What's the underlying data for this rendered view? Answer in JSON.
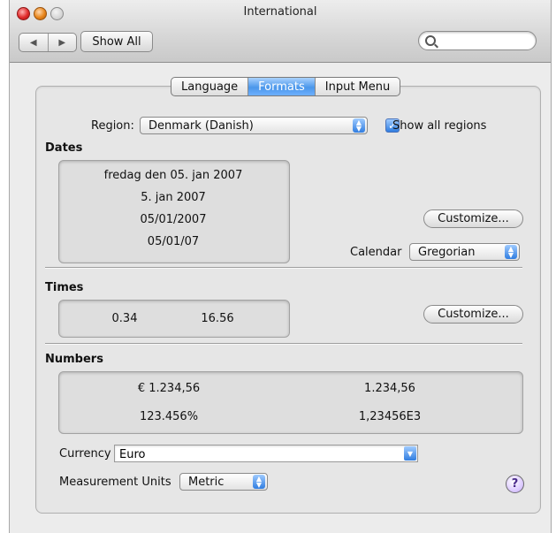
{
  "window": {
    "title": "International"
  },
  "toolbar": {
    "back_glyph": "◀",
    "forward_glyph": "▶",
    "show_all_label": "Show All",
    "search_value": "",
    "search_placeholder": ""
  },
  "tabs": [
    {
      "label": "Language",
      "active": false
    },
    {
      "label": "Formats",
      "active": true
    },
    {
      "label": "Input Menu",
      "active": false
    }
  ],
  "region": {
    "label": "Region:",
    "value": "Denmark (Danish)",
    "show_all_label": "Show all regions",
    "show_all_checked": true
  },
  "dates": {
    "heading": "Dates",
    "samples": [
      "fredag den 05. jan 2007",
      "5. jan 2007",
      "05/01/2007",
      "05/01/07"
    ],
    "customize_label": "Customize...",
    "calendar_label": "Calendar",
    "calendar_value": "Gregorian"
  },
  "times": {
    "heading": "Times",
    "samples": [
      "0.34",
      "16.56"
    ],
    "customize_label": "Customize..."
  },
  "numbers": {
    "heading": "Numbers",
    "currency_sample": "€ 1.234,56",
    "decimal_sample": "1.234,56",
    "percent_sample": "123.456%",
    "scientific_sample": "1,23456E3"
  },
  "currency": {
    "label": "Currency",
    "value": "Euro"
  },
  "measurement": {
    "label": "Measurement Units",
    "value": "Metric"
  },
  "help": {
    "glyph": "?"
  },
  "colors": {
    "accent": "#4b97ea",
    "panel_bg": "#e6e6e6",
    "window_bg": "#ececec"
  }
}
